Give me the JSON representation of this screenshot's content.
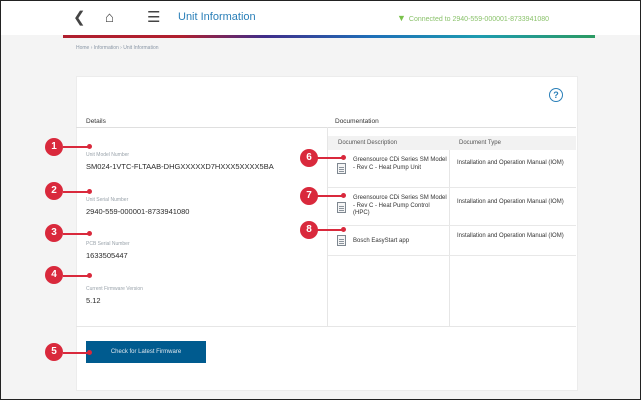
{
  "header": {
    "title": "Unit Information",
    "connection_status": "Connected to 2940-559-000001-8733941080"
  },
  "breadcrumb": "Home › Information › Unit Information",
  "details": {
    "heading": "Details",
    "fields": [
      {
        "label": "Unit Model Number",
        "value": "SM024-1VTC-FLTAAB-DHGXXXXXD7HXXX5XXXX5BA"
      },
      {
        "label": "Unit Serial Number",
        "value": "2940-559-000001-8733941080"
      },
      {
        "label": "PCB Serial Number",
        "value": "1633505447"
      },
      {
        "label": "Current Firmware Version",
        "value": "5.12"
      }
    ],
    "check_button": "Check for Latest Firmware"
  },
  "documentation": {
    "heading": "Documentation",
    "col_description": "Document Description",
    "col_type": "Document Type",
    "rows": [
      {
        "description": "Greensource CDi Series SM Model - Rev C - Heat Pump Unit",
        "type": "Installation and Operation Manual (IOM)"
      },
      {
        "description": "Greensource CDi Series SM Model - Rev C - Heat Pump Control (HPC)",
        "type": "Installation and Operation Manual (IOM)"
      },
      {
        "description": "Bosch EasyStart app",
        "type": "Installation and Operation Manual (IOM)"
      }
    ]
  },
  "callouts": [
    "1",
    "2",
    "3",
    "4",
    "5",
    "6",
    "7",
    "8"
  ],
  "colors": {
    "accent": "#2a7fb8",
    "callout": "#d9293c",
    "button": "#005b8f",
    "connected": "#8ac26b"
  }
}
